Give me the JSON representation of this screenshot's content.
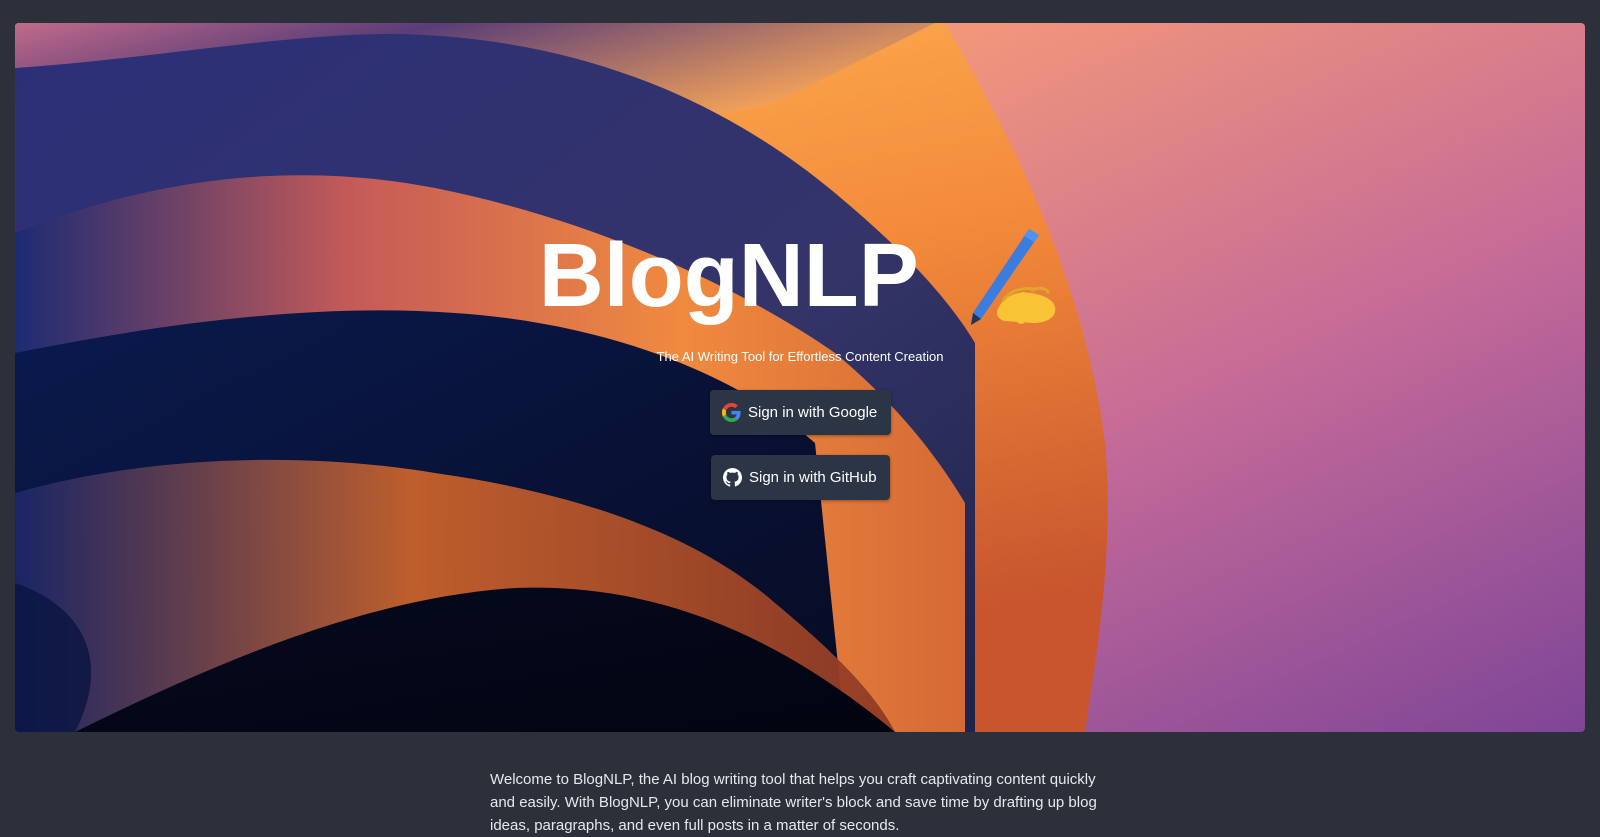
{
  "hero": {
    "title": "BlogNLP",
    "title_emoji_icon": "writing-hand-icon",
    "subtitle": "The AI Writing Tool for Effortless Content Creation",
    "buttons": [
      {
        "label": "Sign in with Google",
        "icon": "google-icon"
      },
      {
        "label": "Sign in with GitHub",
        "icon": "github-icon"
      }
    ]
  },
  "intro": {
    "text": "Welcome to BlogNLP, the AI blog writing tool that helps you craft captivating content quickly and easily. With BlogNLP, you can eliminate writer's block and save time by drafting up blog ideas, paragraphs, and even full posts in a matter of seconds."
  },
  "colors": {
    "page_background": "#2b303b",
    "button_background": "#2c3545",
    "hero_dark": "#1a1f4a",
    "hero_orange": "#f29a45",
    "hero_pink": "#e78c82",
    "hero_purple": "#8e4a97"
  }
}
